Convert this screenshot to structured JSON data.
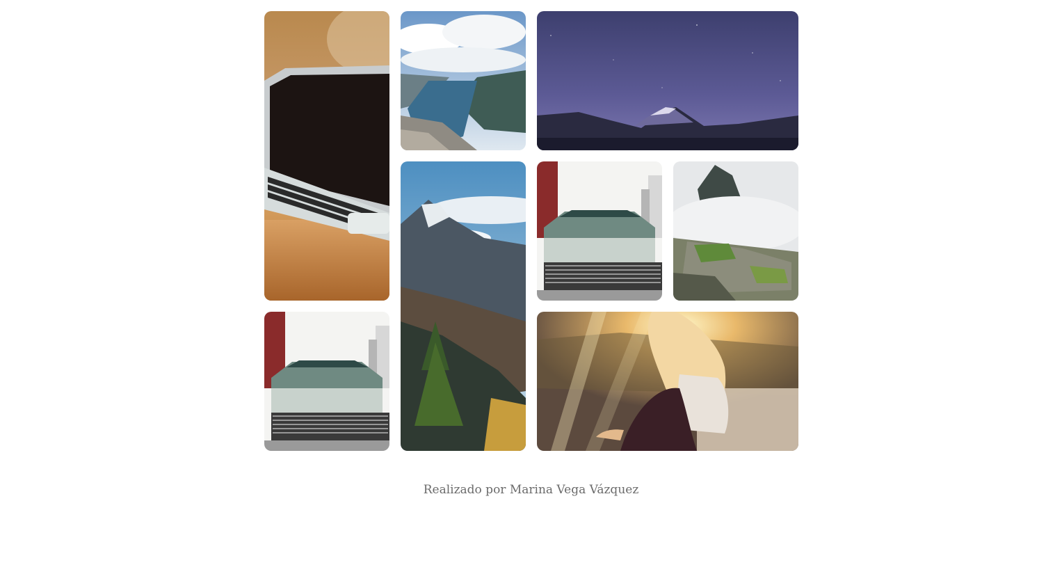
{
  "gallery": {
    "images": [
      {
        "subject": "laptop-on-desk"
      },
      {
        "subject": "fjord-landscape"
      },
      {
        "subject": "starry-night-volcano"
      },
      {
        "subject": "mountain-valley-trees"
      },
      {
        "subject": "vintage-car-front"
      },
      {
        "subject": "misty-mountain-ruins"
      },
      {
        "subject": "vintage-car-front"
      },
      {
        "subject": "woman-at-sunset-lake"
      }
    ]
  },
  "footer": {
    "credit": "Realizado por Marina Vega Vázquez"
  }
}
